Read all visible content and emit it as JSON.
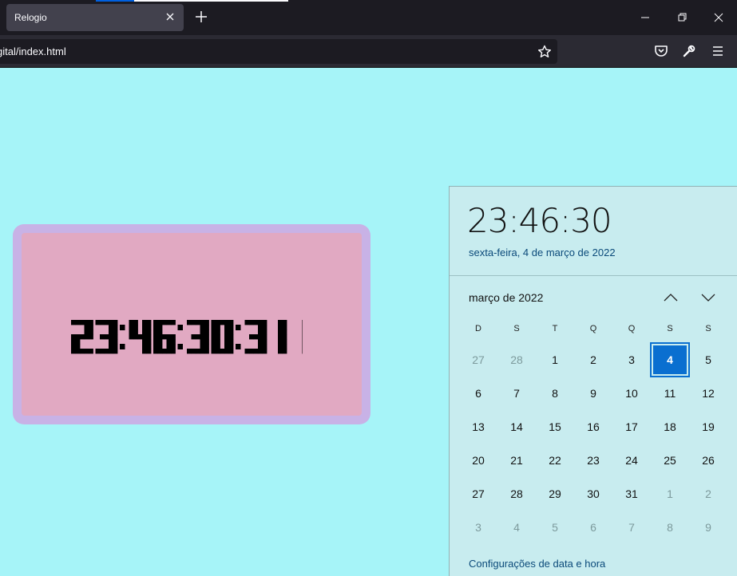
{
  "browser": {
    "tab_title": "Relogio",
    "url": "gital/index.html"
  },
  "colors": {
    "page_bg": "#a6f4f8",
    "clock_frame": "#c8b2e6",
    "clock_face": "#e1a9c2",
    "today_highlight": "#0a6fd0"
  },
  "icons": {
    "tab_close": "close-icon",
    "new_tab": "plus-icon",
    "bookmark": "star-icon",
    "pocket": "pocket-icon",
    "extensions": "wrench-icon",
    "menu": "hamburger-icon"
  },
  "clock": {
    "display": "23:46:30:311"
  },
  "flyout": {
    "time": "23:46:30",
    "date": "sexta-feira, 4 de março de 2022",
    "month_label": "março de 2022",
    "weekdays": [
      "D",
      "S",
      "T",
      "Q",
      "Q",
      "S",
      "S"
    ],
    "days": [
      {
        "n": "27",
        "muted": true
      },
      {
        "n": "28",
        "muted": true
      },
      {
        "n": "1"
      },
      {
        "n": "2"
      },
      {
        "n": "3"
      },
      {
        "n": "4",
        "today": true
      },
      {
        "n": "5"
      },
      {
        "n": "6"
      },
      {
        "n": "7"
      },
      {
        "n": "8"
      },
      {
        "n": "9"
      },
      {
        "n": "10"
      },
      {
        "n": "11"
      },
      {
        "n": "12"
      },
      {
        "n": "13"
      },
      {
        "n": "14"
      },
      {
        "n": "15"
      },
      {
        "n": "16"
      },
      {
        "n": "17"
      },
      {
        "n": "18"
      },
      {
        "n": "19"
      },
      {
        "n": "20"
      },
      {
        "n": "21"
      },
      {
        "n": "22"
      },
      {
        "n": "23"
      },
      {
        "n": "24"
      },
      {
        "n": "25"
      },
      {
        "n": "26"
      },
      {
        "n": "27"
      },
      {
        "n": "28"
      },
      {
        "n": "29"
      },
      {
        "n": "30"
      },
      {
        "n": "31"
      },
      {
        "n": "1",
        "muted": true
      },
      {
        "n": "2",
        "muted": true
      },
      {
        "n": "3",
        "muted": true
      },
      {
        "n": "4",
        "muted": true
      },
      {
        "n": "5",
        "muted": true
      },
      {
        "n": "6",
        "muted": true
      },
      {
        "n": "7",
        "muted": true
      },
      {
        "n": "8",
        "muted": true
      },
      {
        "n": "9",
        "muted": true
      }
    ],
    "settings_link": "Configurações de data e hora"
  }
}
